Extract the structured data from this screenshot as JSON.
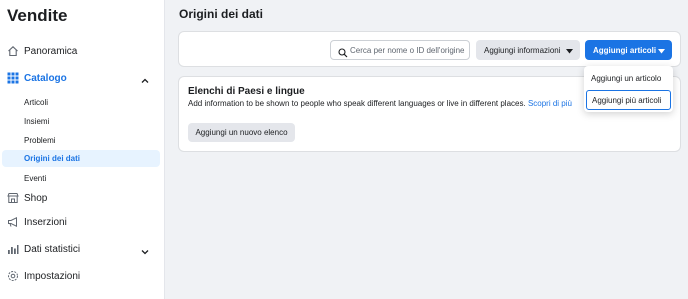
{
  "sidebar": {
    "app_title": "Vendite",
    "items": [
      {
        "label": "Panoramica",
        "icon": "home-icon"
      },
      {
        "label": "Catalogo",
        "icon": "grid-icon",
        "expanded": true
      },
      {
        "label": "Shop",
        "icon": "store-icon"
      },
      {
        "label": "Inserzioni",
        "icon": "megaphone-icon"
      },
      {
        "label": "Dati statistici",
        "icon": "bar-chart-icon"
      },
      {
        "label": "Impostazioni",
        "icon": "gear-icon"
      }
    ],
    "catalog_subitems": [
      {
        "label": "Articoli"
      },
      {
        "label": "Insiemi"
      },
      {
        "label": "Problemi"
      },
      {
        "label": "Origini dei dati",
        "selected": true
      },
      {
        "label": "Eventi"
      }
    ]
  },
  "main": {
    "title": "Origini dei dati",
    "search": {
      "placeholder": "Cerca per nome o ID dell'origine"
    },
    "add_info_label": "Aggiungi informazioni",
    "add_items_label": "Aggiungi articoli",
    "dropdown": [
      {
        "label": "Aggiungi un articolo"
      },
      {
        "label": "Aggiungi più articoli",
        "focused": true
      }
    ],
    "card": {
      "title": "Elenchi di Paesi e lingue",
      "description": "Add information to be shown to people who speak different languages or live in different places.",
      "link": "Scopri di più",
      "button": "Aggiungi un nuovo elenco"
    }
  },
  "colors": {
    "accent": "#1b74e4",
    "background": "#f0f2f5",
    "selected_bg": "#e7f3ff"
  }
}
